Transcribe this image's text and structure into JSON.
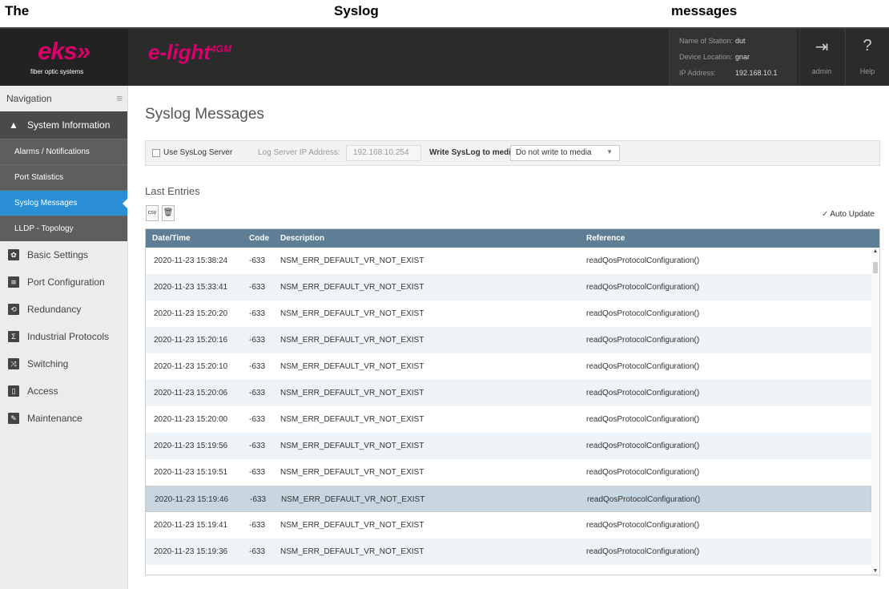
{
  "caption": {
    "w1": "The",
    "w2": "Syslog",
    "w3": "messages"
  },
  "header": {
    "logo": "eks»",
    "logo_sub": "fiber optic systems",
    "product": "e-light",
    "product_sup": "4GM",
    "station": [
      {
        "label": "Name of Station:",
        "value": "dut"
      },
      {
        "label": "Device Location:",
        "value": "gnar"
      },
      {
        "label": "IP Address:",
        "value": "192.168.10.1"
      }
    ],
    "admin_label": "admin",
    "help_label": "Help"
  },
  "sidebar": {
    "title": "Navigation",
    "system_information": "System Information",
    "sub_items": [
      {
        "label": "Alarms / Notifications"
      },
      {
        "label": "Port Statistics"
      },
      {
        "label": "Syslog Messages"
      },
      {
        "label": "LLDP - Topology"
      }
    ],
    "items": [
      {
        "label": "Basic Settings",
        "icon": "gear-icon"
      },
      {
        "label": "Port Configuration",
        "icon": "port-icon"
      },
      {
        "label": "Redundancy",
        "icon": "redundancy-icon"
      },
      {
        "label": "Industrial Protocols",
        "icon": "protocol-icon"
      },
      {
        "label": "Switching",
        "icon": "switching-icon"
      },
      {
        "label": "Access",
        "icon": "lock-icon"
      },
      {
        "label": "Maintenance",
        "icon": "wrench-icon"
      }
    ]
  },
  "main": {
    "title": "Syslog Messages",
    "settings": {
      "use_syslog_label": "Use SysLog Server",
      "use_syslog_checked": false,
      "server_ip_label": "Log Server IP Address:",
      "server_ip_value": "192.168.10.254",
      "write_media_label": "Write SysLog to media:",
      "write_media_value": "Do not write to media"
    },
    "last_entries_title": "Last Entries",
    "csv_label": "csv",
    "auto_update_label": "Auto Update",
    "auto_update_checked": true,
    "columns": [
      "Date/Time",
      "Code",
      "Description",
      "Reference"
    ],
    "rows": [
      {
        "datetime": "2020-11-23 15:38:24",
        "code": "-633",
        "description": "NSM_ERR_DEFAULT_VR_NOT_EXIST",
        "reference": "readQosProtocolConfiguration()"
      },
      {
        "datetime": "2020-11-23 15:33:41",
        "code": "-633",
        "description": "NSM_ERR_DEFAULT_VR_NOT_EXIST",
        "reference": "readQosProtocolConfiguration()"
      },
      {
        "datetime": "2020-11-23 15:20:20",
        "code": "-633",
        "description": "NSM_ERR_DEFAULT_VR_NOT_EXIST",
        "reference": "readQosProtocolConfiguration()"
      },
      {
        "datetime": "2020-11-23 15:20:16",
        "code": "-633",
        "description": "NSM_ERR_DEFAULT_VR_NOT_EXIST",
        "reference": "readQosProtocolConfiguration()"
      },
      {
        "datetime": "2020-11-23 15:20:10",
        "code": "-633",
        "description": "NSM_ERR_DEFAULT_VR_NOT_EXIST",
        "reference": "readQosProtocolConfiguration()"
      },
      {
        "datetime": "2020-11-23 15:20:06",
        "code": "-633",
        "description": "NSM_ERR_DEFAULT_VR_NOT_EXIST",
        "reference": "readQosProtocolConfiguration()"
      },
      {
        "datetime": "2020-11-23 15:20:00",
        "code": "-633",
        "description": "NSM_ERR_DEFAULT_VR_NOT_EXIST",
        "reference": "readQosProtocolConfiguration()"
      },
      {
        "datetime": "2020-11-23 15:19:56",
        "code": "-633",
        "description": "NSM_ERR_DEFAULT_VR_NOT_EXIST",
        "reference": "readQosProtocolConfiguration()"
      },
      {
        "datetime": "2020-11-23 15:19:51",
        "code": "-633",
        "description": "NSM_ERR_DEFAULT_VR_NOT_EXIST",
        "reference": "readQosProtocolConfiguration()"
      },
      {
        "datetime": "2020-11-23 15:19:46",
        "code": "-633",
        "description": "NSM_ERR_DEFAULT_VR_NOT_EXIST",
        "reference": "readQosProtocolConfiguration()"
      },
      {
        "datetime": "2020-11-23 15:19:41",
        "code": "-633",
        "description": "NSM_ERR_DEFAULT_VR_NOT_EXIST",
        "reference": "readQosProtocolConfiguration()"
      },
      {
        "datetime": "2020-11-23 15:19:36",
        "code": "-633",
        "description": "NSM_ERR_DEFAULT_VR_NOT_EXIST",
        "reference": "readQosProtocolConfiguration()"
      }
    ]
  },
  "colors": {
    "brand": "#d9006c",
    "active_nav": "#2b8fd6",
    "table_header": "#5d7e94",
    "row_selected": "#c7d6e1"
  }
}
